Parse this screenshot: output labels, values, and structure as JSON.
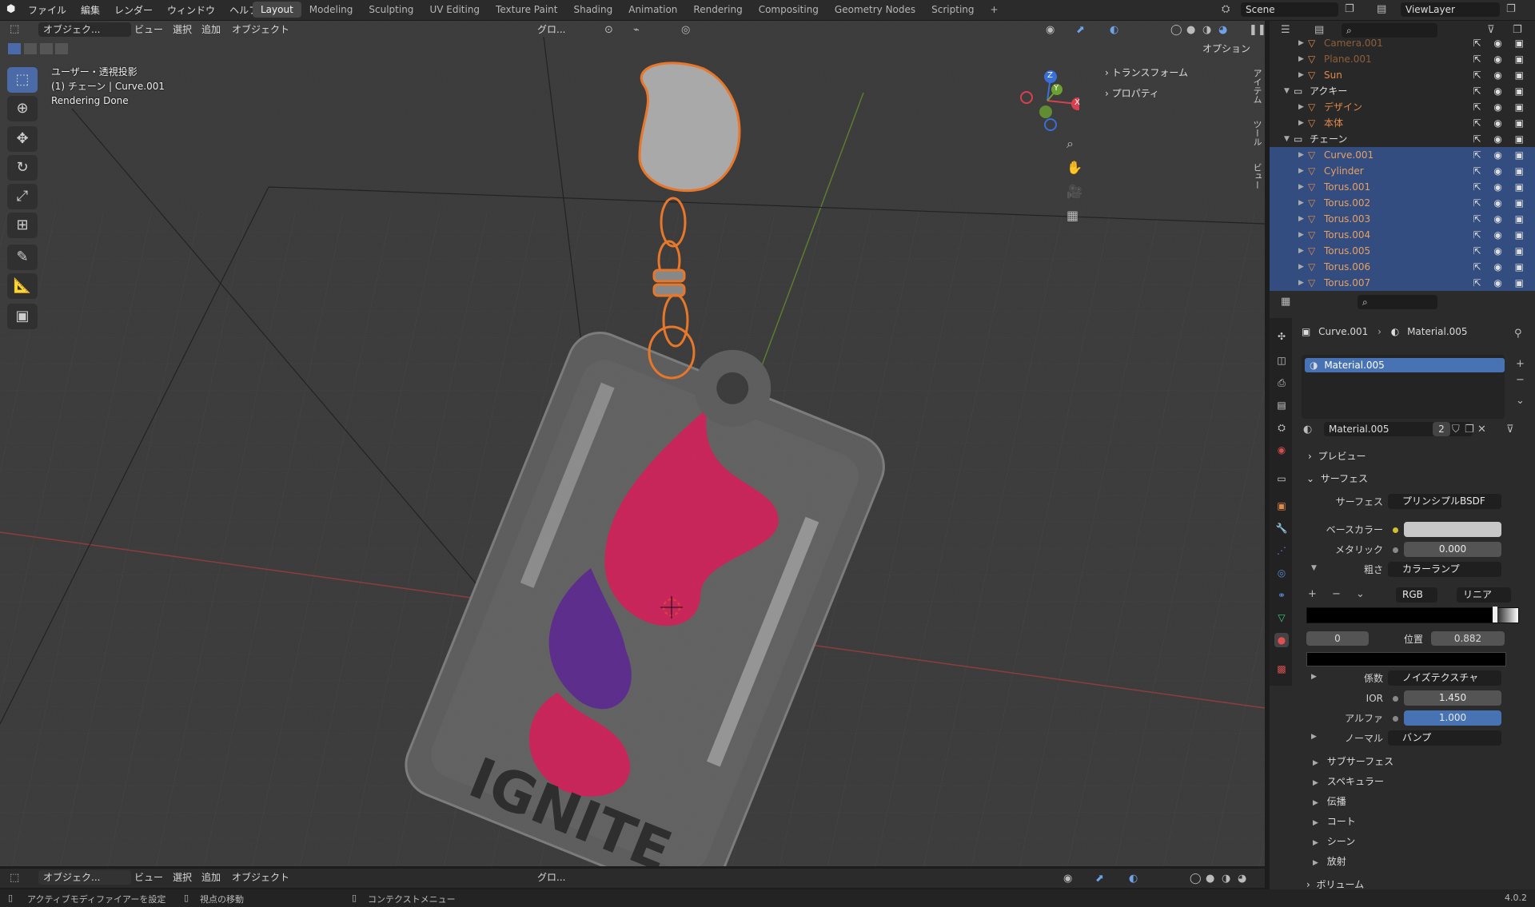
{
  "topbar": {
    "menus": [
      "ファイル",
      "編集",
      "レンダー",
      "ウィンドウ",
      "ヘルプ"
    ],
    "workspaces": [
      "Layout",
      "Modeling",
      "Sculpting",
      "UV Editing",
      "Texture Paint",
      "Shading",
      "Animation",
      "Rendering",
      "Compositing",
      "Geometry Nodes",
      "Scripting"
    ],
    "active_workspace": "Layout",
    "add_tab": "+",
    "scene": "Scene",
    "view_layer": "ViewLayer"
  },
  "viewport_header": {
    "mode": "オブジェク...",
    "menus": [
      "ビュー",
      "選択",
      "追加",
      "オブジェクト"
    ],
    "orientation": "グロ...",
    "options": "オプション"
  },
  "overlay": {
    "view": "ユーザー・透視投影",
    "object": "(1) チェーン | Curve.001",
    "status": "Rendering Done"
  },
  "npanel": {
    "transform": "トランスフォーム",
    "properties": "プロパティ",
    "tabs": [
      "アイテム",
      "ツール",
      "ビュー"
    ]
  },
  "gizmo": {
    "x": "X",
    "y": "Y",
    "z": "Z"
  },
  "outliner": {
    "rows": [
      {
        "name": "Camera.001",
        "depth": 2,
        "dim": true
      },
      {
        "name": "Plane.001",
        "depth": 2,
        "dim": true
      },
      {
        "name": "Sun",
        "depth": 2
      },
      {
        "name": "アクキー",
        "depth": 1,
        "collection": true
      },
      {
        "name": "デザイン",
        "depth": 2
      },
      {
        "name": "本体",
        "depth": 2
      },
      {
        "name": "チェーン",
        "depth": 1,
        "collection": true
      },
      {
        "name": "Curve.001",
        "depth": 2,
        "selected": true,
        "active": true
      },
      {
        "name": "Cylinder",
        "depth": 2,
        "selected": true
      },
      {
        "name": "Torus.001",
        "depth": 2,
        "selected": true
      },
      {
        "name": "Torus.002",
        "depth": 2,
        "selected": true
      },
      {
        "name": "Torus.003",
        "depth": 2,
        "selected": true
      },
      {
        "name": "Torus.004",
        "depth": 2,
        "selected": true
      },
      {
        "name": "Torus.005",
        "depth": 2,
        "selected": true
      },
      {
        "name": "Torus.006",
        "depth": 2,
        "selected": true
      },
      {
        "name": "Torus.007",
        "depth": 2,
        "selected": true
      }
    ]
  },
  "properties": {
    "breadcrumb_object": "Curve.001",
    "breadcrumb_material": "Material.005",
    "slot": "Material.005",
    "material_name": "Material.005",
    "users": "2",
    "preview": "プレビュー",
    "surface_header": "サーフェス",
    "surface_label": "サーフェス",
    "surface_value": "プリンシプルBSDF",
    "base_color_label": "ベースカラー",
    "metallic_label": "メタリック",
    "metallic_value": "0.000",
    "roughness_label": "粗さ",
    "roughness_value": "カラーランプ",
    "ramp_mode": "RGB",
    "ramp_interp": "リニア",
    "ramp_index": "0",
    "ramp_pos_label": "位置",
    "ramp_pos_value": "0.882",
    "factor_label": "係数",
    "factor_value": "ノイズテクスチャ",
    "ior_label": "IOR",
    "ior_value": "1.450",
    "alpha_label": "アルファ",
    "alpha_value": "1.000",
    "normal_label": "ノーマル",
    "normal_value": "バンプ",
    "subsections": [
      "サブサーフェス",
      "スペキュラー",
      "伝播",
      "コート",
      "シーン",
      "放射"
    ],
    "volume": "ボリューム"
  },
  "bottom_header": {
    "mode": "オブジェク...",
    "menus": [
      "ビュー",
      "選択",
      "追加",
      "オブジェクト"
    ],
    "orientation": "グロ..."
  },
  "statusbar": {
    "hint1": "アクティブモディファイアーを設定",
    "hint2": "視点の移動",
    "hint3": "コンテクストメニュー",
    "version": "4.0.2"
  },
  "colors": {
    "accent": "#4772b3",
    "selection_orange": "#e8772a",
    "pink": "#d0245c",
    "purple": "#6a2a90"
  },
  "icons": [
    "blender-logo-icon",
    "select-box-icon",
    "cursor-icon",
    "move-icon",
    "rotate-icon",
    "scale-icon",
    "transform-icon",
    "annotate-icon",
    "measure-icon",
    "add-cube-icon",
    "zoom-icon",
    "hand-icon",
    "camera-icon",
    "grid-icon",
    "eye-icon",
    "filter-icon",
    "search-icon",
    "pin-icon"
  ]
}
